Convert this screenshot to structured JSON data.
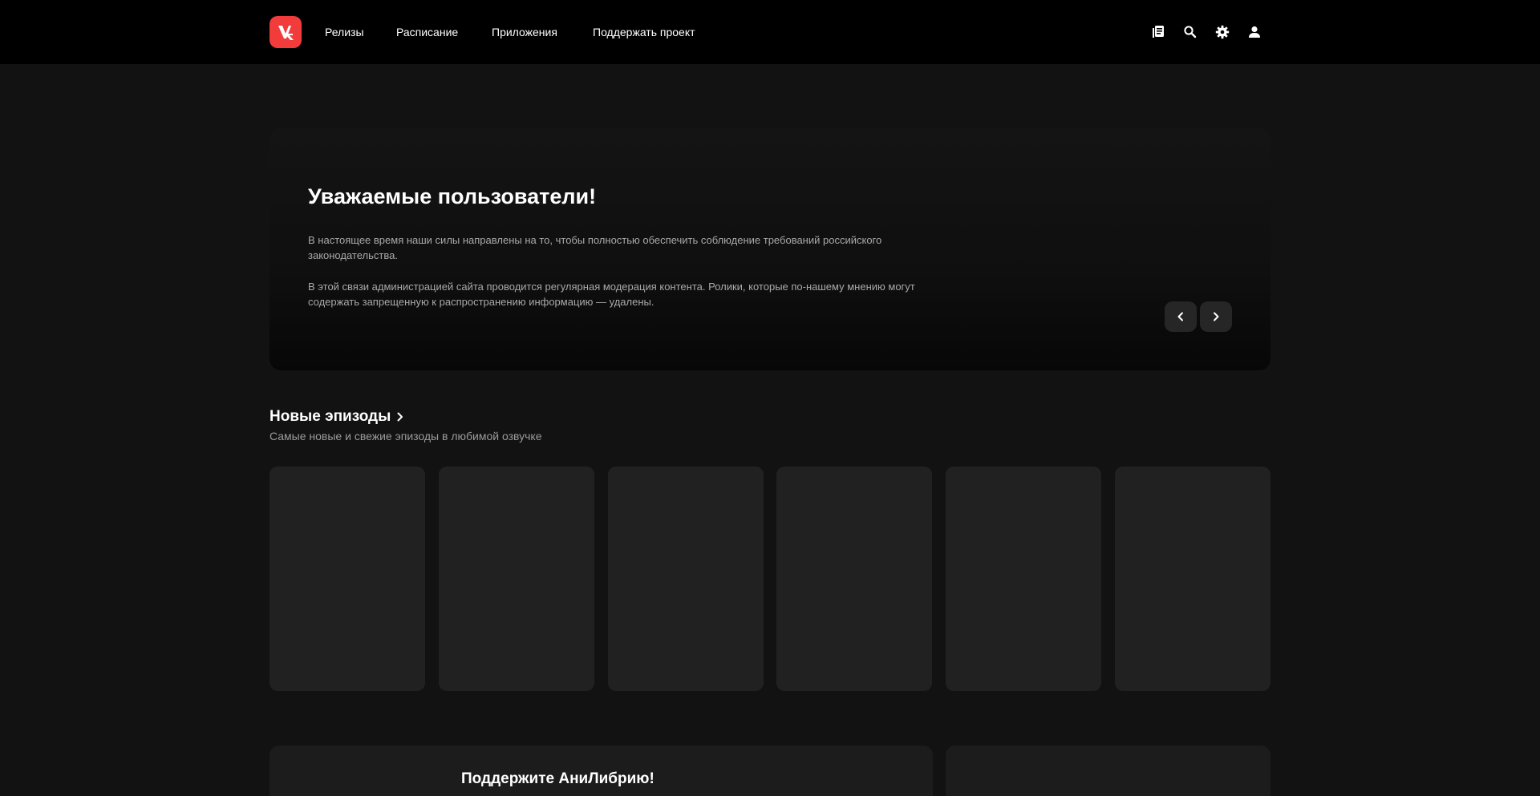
{
  "header": {
    "logo_icon": "anilibria-logo",
    "accent_color": "#f23c3c",
    "nav": [
      {
        "label": "Релизы"
      },
      {
        "label": "Расписание"
      },
      {
        "label": "Приложения"
      },
      {
        "label": "Поддержать проект"
      }
    ],
    "icons": [
      "library-icon",
      "search-icon",
      "gear-icon",
      "user-icon"
    ]
  },
  "banner": {
    "title": "Уважаемые пользователи!",
    "paragraph_1": "В настоящее время наши силы направлены на то, чтобы полностью обеспечить соблюдение требований российского законодательства.",
    "paragraph_2": "В этой связи администрацией сайта проводится регулярная модерация контента. Ролики, которые по-нашему мнению могут содержать запрещенную к распространению информацию — удалены.",
    "prev_icon": "chevron-left-icon",
    "next_icon": "chevron-right-icon"
  },
  "new_episodes": {
    "title": "Новые эпизоды",
    "subtitle": "Самые новые и свежие эпизоды в любимой озвучке",
    "cards_count": 6
  },
  "support": {
    "title": "Поддержите АниЛибрию!"
  }
}
